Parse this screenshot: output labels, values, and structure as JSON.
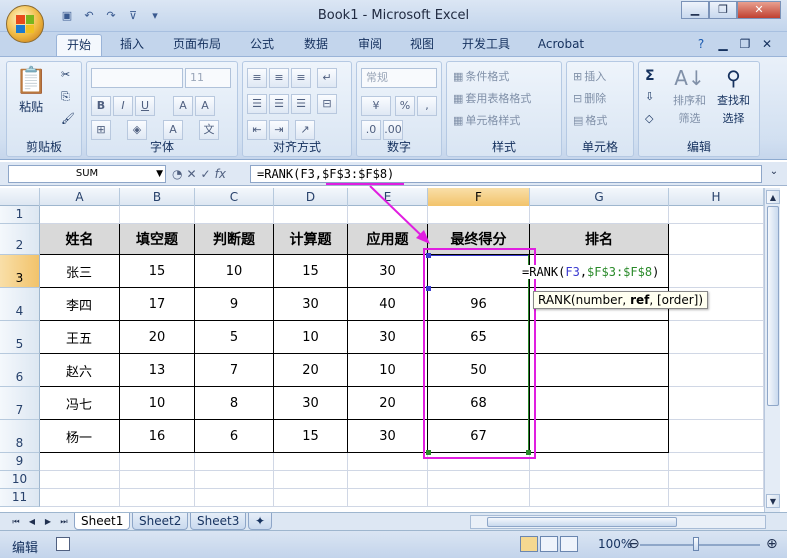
{
  "window": {
    "title": "Book1 - Microsoft Excel"
  },
  "quick_access": [
    "save-icon",
    "undo-icon",
    "redo-icon",
    "format-icon",
    "customize-icon"
  ],
  "tabs": [
    "开始",
    "插入",
    "页面布局",
    "公式",
    "数据",
    "审阅",
    "视图",
    "开发工具",
    "Acrobat"
  ],
  "active_tab": "开始",
  "ribbon": {
    "clipboard": {
      "label": "剪贴板",
      "paste": "粘贴"
    },
    "font": {
      "label": "字体",
      "size": "11"
    },
    "alignment": {
      "label": "对齐方式"
    },
    "number": {
      "label": "数字",
      "format": "常规"
    },
    "styles": {
      "label": "样式",
      "conditional": "条件格式",
      "table": "套用表格格式",
      "cell": "单元格样式"
    },
    "cells": {
      "label": "单元格",
      "insert": "插入",
      "delete": "删除",
      "format": "格式"
    },
    "editing": {
      "label": "编辑",
      "sort": "排序和",
      "filter": "筛选",
      "find": "查找和",
      "select": "选择"
    }
  },
  "formula_bar": {
    "name_box": "SUM",
    "formula": "=RANK(F3,$F$3:$F$8)"
  },
  "columns": [
    "A",
    "B",
    "C",
    "D",
    "E",
    "F",
    "G",
    "H"
  ],
  "rows": [
    "1",
    "2",
    "3",
    "4",
    "5",
    "6",
    "7",
    "8",
    "9",
    "10",
    "11"
  ],
  "table": {
    "headers": [
      "姓名",
      "填空题",
      "判断题",
      "计算题",
      "应用题",
      "最终得分",
      "排名"
    ],
    "rows": [
      [
        "张三",
        "15",
        "10",
        "15",
        "30",
        "",
        ""
      ],
      [
        "李四",
        "17",
        "9",
        "30",
        "40",
        "96",
        ""
      ],
      [
        "王五",
        "20",
        "5",
        "10",
        "30",
        "65",
        ""
      ],
      [
        "赵六",
        "13",
        "7",
        "20",
        "10",
        "50",
        ""
      ],
      [
        "冯七",
        "10",
        "8",
        "30",
        "20",
        "68",
        ""
      ],
      [
        "杨一",
        "16",
        "6",
        "15",
        "30",
        "67",
        ""
      ]
    ]
  },
  "incell_formula": {
    "prefix": "=RANK(",
    "ref1": "F3",
    "sep": ",",
    "ref2": "$F$3:$F$8",
    "suffix": ")"
  },
  "tooltip": {
    "func": "RANK(number, ",
    "bold": "ref",
    "rest": ", [order])"
  },
  "sheets": [
    "Sheet1",
    "Sheet2",
    "Sheet3"
  ],
  "active_sheet": "Sheet1",
  "status": {
    "mode": "编辑",
    "zoom": "100%"
  },
  "colors": {
    "annotation": "#e01ee0",
    "ref1": "#3a3ad0",
    "ref2": "#2a8a2a"
  }
}
